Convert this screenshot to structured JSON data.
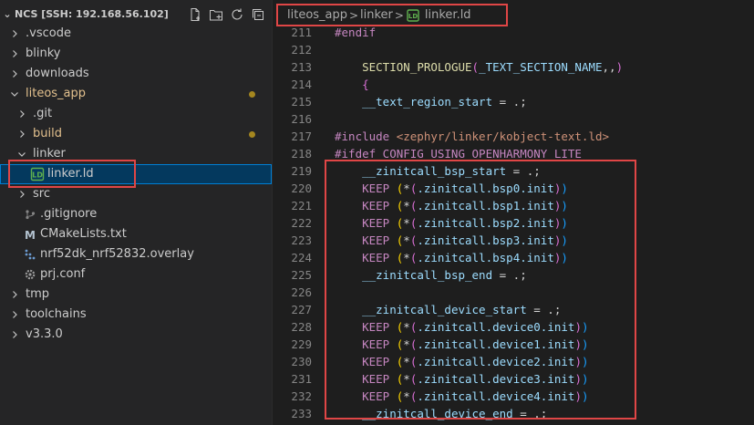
{
  "explorer": {
    "title": "NCS [SSH: 192.168.56.102]",
    "actions": [
      {
        "name": "new-file-icon"
      },
      {
        "name": "new-folder-icon"
      },
      {
        "name": "refresh-icon"
      },
      {
        "name": "collapse-all-icon"
      }
    ],
    "items": [
      {
        "label": ".vscode",
        "type": "folder",
        "expanded": false,
        "depth": 0
      },
      {
        "label": "blinky",
        "type": "folder",
        "expanded": false,
        "depth": 0
      },
      {
        "label": "downloads",
        "type": "folder",
        "expanded": false,
        "depth": 0
      },
      {
        "label": "liteos_app",
        "type": "folder",
        "expanded": true,
        "depth": 0,
        "modified": true
      },
      {
        "label": ".git",
        "type": "folder",
        "expanded": false,
        "depth": 1
      },
      {
        "label": "build",
        "type": "folder",
        "expanded": false,
        "depth": 1,
        "modified": true
      },
      {
        "label": "linker",
        "type": "folder",
        "expanded": true,
        "depth": 1
      },
      {
        "label": "linker.ld",
        "type": "ld-file",
        "depth": 2,
        "selected": true
      },
      {
        "label": "src",
        "type": "folder",
        "expanded": false,
        "depth": 1
      },
      {
        "label": ".gitignore",
        "type": "git-file",
        "depth": 1
      },
      {
        "label": "CMakeLists.txt",
        "type": "cmake-file",
        "depth": 1
      },
      {
        "label": "nrf52dk_nrf52832.overlay",
        "type": "devicetree-file",
        "depth": 1
      },
      {
        "label": "prj.conf",
        "type": "config-file",
        "depth": 1
      },
      {
        "label": "tmp",
        "type": "folder",
        "expanded": false,
        "depth": 0
      },
      {
        "label": "toolchains",
        "type": "folder",
        "expanded": false,
        "depth": 0
      },
      {
        "label": "v3.3.0",
        "type": "folder",
        "expanded": false,
        "depth": 0
      }
    ]
  },
  "breadcrumb": {
    "items": [
      "liteos_app",
      "linker",
      "linker.ld"
    ],
    "separator": ">"
  },
  "editor": {
    "lines": [
      {
        "n": "211",
        "tokens": [
          {
            "t": "#endif",
            "c": "c-dir"
          }
        ]
      },
      {
        "n": "212",
        "tokens": []
      },
      {
        "n": "213",
        "tokens": [
          {
            "t": "    ",
            "c": "c-plain"
          },
          {
            "t": "SECTION_PROLOGUE",
            "c": "c-fn"
          },
          {
            "t": "(",
            "c": "c-p1"
          },
          {
            "t": "_TEXT_SECTION_NAME",
            "c": "c-id"
          },
          {
            "t": ",,",
            "c": "c-plain"
          },
          {
            "t": ")",
            "c": "c-p1"
          }
        ]
      },
      {
        "n": "214",
        "tokens": [
          {
            "t": "    ",
            "c": "c-plain"
          },
          {
            "t": "{",
            "c": "c-p1"
          }
        ]
      },
      {
        "n": "215",
        "tokens": [
          {
            "t": "    ",
            "c": "c-plain"
          },
          {
            "t": "__text_region_start",
            "c": "c-id"
          },
          {
            "t": " = .;",
            "c": "c-plain"
          }
        ]
      },
      {
        "n": "216",
        "tokens": []
      },
      {
        "n": "217",
        "tokens": [
          {
            "t": "#include ",
            "c": "c-dir"
          },
          {
            "t": "<zephyr/linker/kobject-text.ld>",
            "c": "c-str"
          }
        ]
      },
      {
        "n": "218",
        "tokens": [
          {
            "t": "#ifdef CONFIG_USING_OPENHARMONY_LITE",
            "c": "c-dir"
          }
        ]
      },
      {
        "n": "219",
        "tokens": [
          {
            "t": "    ",
            "c": "c-plain"
          },
          {
            "t": "__zinitcall_bsp_start",
            "c": "c-id"
          },
          {
            "t": " = .;",
            "c": "c-plain"
          }
        ]
      },
      {
        "n": "220",
        "tokens": [
          {
            "t": "    ",
            "c": "c-plain"
          },
          {
            "t": "KEEP",
            "c": "c-kw"
          },
          {
            "t": " ",
            "c": "c-plain"
          },
          {
            "t": "(",
            "c": "c-p2"
          },
          {
            "t": "*",
            "c": "c-plain"
          },
          {
            "t": "(",
            "c": "c-p1"
          },
          {
            "t": ".zinitcall.bsp0.init",
            "c": "c-id"
          },
          {
            "t": ")",
            "c": "c-p1"
          },
          {
            "t": ")",
            "c": "c-p3"
          }
        ]
      },
      {
        "n": "221",
        "tokens": [
          {
            "t": "    ",
            "c": "c-plain"
          },
          {
            "t": "KEEP",
            "c": "c-kw"
          },
          {
            "t": " ",
            "c": "c-plain"
          },
          {
            "t": "(",
            "c": "c-p2"
          },
          {
            "t": "*",
            "c": "c-plain"
          },
          {
            "t": "(",
            "c": "c-p1"
          },
          {
            "t": ".zinitcall.bsp1.init",
            "c": "c-id"
          },
          {
            "t": ")",
            "c": "c-p1"
          },
          {
            "t": ")",
            "c": "c-p3"
          }
        ]
      },
      {
        "n": "222",
        "tokens": [
          {
            "t": "    ",
            "c": "c-plain"
          },
          {
            "t": "KEEP",
            "c": "c-kw"
          },
          {
            "t": " ",
            "c": "c-plain"
          },
          {
            "t": "(",
            "c": "c-p2"
          },
          {
            "t": "*",
            "c": "c-plain"
          },
          {
            "t": "(",
            "c": "c-p1"
          },
          {
            "t": ".zinitcall.bsp2.init",
            "c": "c-id"
          },
          {
            "t": ")",
            "c": "c-p1"
          },
          {
            "t": ")",
            "c": "c-p3"
          }
        ]
      },
      {
        "n": "223",
        "tokens": [
          {
            "t": "    ",
            "c": "c-plain"
          },
          {
            "t": "KEEP",
            "c": "c-kw"
          },
          {
            "t": " ",
            "c": "c-plain"
          },
          {
            "t": "(",
            "c": "c-p2"
          },
          {
            "t": "*",
            "c": "c-plain"
          },
          {
            "t": "(",
            "c": "c-p1"
          },
          {
            "t": ".zinitcall.bsp3.init",
            "c": "c-id"
          },
          {
            "t": ")",
            "c": "c-p1"
          },
          {
            "t": ")",
            "c": "c-p3"
          }
        ]
      },
      {
        "n": "224",
        "tokens": [
          {
            "t": "    ",
            "c": "c-plain"
          },
          {
            "t": "KEEP",
            "c": "c-kw"
          },
          {
            "t": " ",
            "c": "c-plain"
          },
          {
            "t": "(",
            "c": "c-p2"
          },
          {
            "t": "*",
            "c": "c-plain"
          },
          {
            "t": "(",
            "c": "c-p1"
          },
          {
            "t": ".zinitcall.bsp4.init",
            "c": "c-id"
          },
          {
            "t": ")",
            "c": "c-p1"
          },
          {
            "t": ")",
            "c": "c-p3"
          }
        ]
      },
      {
        "n": "225",
        "tokens": [
          {
            "t": "    ",
            "c": "c-plain"
          },
          {
            "t": "__zinitcall_bsp_end",
            "c": "c-id"
          },
          {
            "t": " = .;",
            "c": "c-plain"
          }
        ]
      },
      {
        "n": "226",
        "tokens": []
      },
      {
        "n": "227",
        "tokens": [
          {
            "t": "    ",
            "c": "c-plain"
          },
          {
            "t": "__zinitcall_device_start",
            "c": "c-id"
          },
          {
            "t": " = .;",
            "c": "c-plain"
          }
        ]
      },
      {
        "n": "228",
        "tokens": [
          {
            "t": "    ",
            "c": "c-plain"
          },
          {
            "t": "KEEP",
            "c": "c-kw"
          },
          {
            "t": " ",
            "c": "c-plain"
          },
          {
            "t": "(",
            "c": "c-p2"
          },
          {
            "t": "*",
            "c": "c-plain"
          },
          {
            "t": "(",
            "c": "c-p1"
          },
          {
            "t": ".zinitcall.device0.init",
            "c": "c-id"
          },
          {
            "t": ")",
            "c": "c-p1"
          },
          {
            "t": ")",
            "c": "c-p3"
          }
        ]
      },
      {
        "n": "229",
        "tokens": [
          {
            "t": "    ",
            "c": "c-plain"
          },
          {
            "t": "KEEP",
            "c": "c-kw"
          },
          {
            "t": " ",
            "c": "c-plain"
          },
          {
            "t": "(",
            "c": "c-p2"
          },
          {
            "t": "*",
            "c": "c-plain"
          },
          {
            "t": "(",
            "c": "c-p1"
          },
          {
            "t": ".zinitcall.device1.init",
            "c": "c-id"
          },
          {
            "t": ")",
            "c": "c-p1"
          },
          {
            "t": ")",
            "c": "c-p3"
          }
        ]
      },
      {
        "n": "230",
        "tokens": [
          {
            "t": "    ",
            "c": "c-plain"
          },
          {
            "t": "KEEP",
            "c": "c-kw"
          },
          {
            "t": " ",
            "c": "c-plain"
          },
          {
            "t": "(",
            "c": "c-p2"
          },
          {
            "t": "*",
            "c": "c-plain"
          },
          {
            "t": "(",
            "c": "c-p1"
          },
          {
            "t": ".zinitcall.device2.init",
            "c": "c-id"
          },
          {
            "t": ")",
            "c": "c-p1"
          },
          {
            "t": ")",
            "c": "c-p3"
          }
        ]
      },
      {
        "n": "231",
        "tokens": [
          {
            "t": "    ",
            "c": "c-plain"
          },
          {
            "t": "KEEP",
            "c": "c-kw"
          },
          {
            "t": " ",
            "c": "c-plain"
          },
          {
            "t": "(",
            "c": "c-p2"
          },
          {
            "t": "*",
            "c": "c-plain"
          },
          {
            "t": "(",
            "c": "c-p1"
          },
          {
            "t": ".zinitcall.device3.init",
            "c": "c-id"
          },
          {
            "t": ")",
            "c": "c-p1"
          },
          {
            "t": ")",
            "c": "c-p3"
          }
        ]
      },
      {
        "n": "232",
        "tokens": [
          {
            "t": "    ",
            "c": "c-plain"
          },
          {
            "t": "KEEP",
            "c": "c-kw"
          },
          {
            "t": " ",
            "c": "c-plain"
          },
          {
            "t": "(",
            "c": "c-p2"
          },
          {
            "t": "*",
            "c": "c-plain"
          },
          {
            "t": "(",
            "c": "c-p1"
          },
          {
            "t": ".zinitcall.device4.init",
            "c": "c-id"
          },
          {
            "t": ")",
            "c": "c-p1"
          },
          {
            "t": ")",
            "c": "c-p3"
          }
        ]
      },
      {
        "n": "233",
        "tokens": [
          {
            "t": "    ",
            "c": "c-plain"
          },
          {
            "t": "__zinitcall_device_end",
            "c": "c-id"
          },
          {
            "t": " = .;",
            "c": "c-plain"
          }
        ]
      }
    ]
  },
  "colors": {
    "annotation_box": "#e04646",
    "selection_bg": "#04395e",
    "selection_border": "#007fd4",
    "modified_text": "#e2c08d",
    "modified_dot": "#a5871f"
  }
}
